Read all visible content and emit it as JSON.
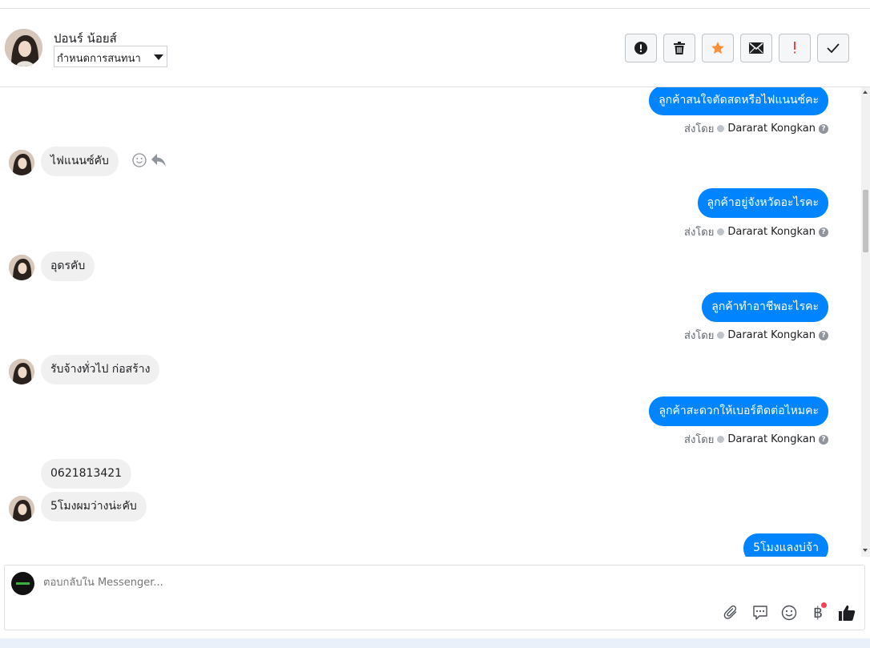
{
  "header": {
    "contact_name": "ปอนร์ น้อยส์",
    "status_select_value": "กำหนดการสนทนา",
    "actions": [
      {
        "icon": "alert-circle-icon"
      },
      {
        "icon": "trash-icon"
      },
      {
        "icon": "star-icon",
        "color": "#f7923b"
      },
      {
        "icon": "envelope-icon"
      },
      {
        "icon": "exclamation-icon",
        "color": "#fa3e3e"
      },
      {
        "icon": "checkmark-icon"
      }
    ]
  },
  "conversation": {
    "outgoing": [
      {
        "text": "ลูกค้าสนใจตัดสดหรือไฟแนนซ์คะ",
        "via": "ส่งโดย",
        "sender": "Dararat Kongkan"
      },
      {
        "text": "ลูกค้าอยู่จังหวัดอะไรคะ",
        "via": "ส่งโดย",
        "sender": "Dararat Kongkan"
      },
      {
        "text": "ลูกค้าทำอาชีพอะไรคะ",
        "via": "ส่งโดย",
        "sender": "Dararat Kongkan"
      },
      {
        "text": "ลูกค้าสะดวกให้เบอร์ติดต่อไหมคะ",
        "via": "ส่งโดย",
        "sender": "Dararat Kongkan"
      },
      {
        "text": "5โมงแลงบ่จ้า"
      }
    ],
    "incoming": [
      {
        "text": "ไฟแนนซ์คับ"
      },
      {
        "text": "อุดรคับ"
      },
      {
        "text": "รับจ้างทั่วไป ก่อสร้าง"
      },
      {
        "text": "0621813421"
      },
      {
        "text": "5โมงผมว่างน่ะคับ"
      }
    ]
  },
  "composer": {
    "placeholder": "ตอบกลับใน Messenger...",
    "tools": [
      "paperclip-icon",
      "saved-reply-icon",
      "emoji-icon",
      "baht-payment-icon",
      "thumbs-up-icon"
    ],
    "baht_symbol": "฿"
  },
  "colors": {
    "outgoing_bubble": "#0084ff",
    "incoming_bubble": "#f0f0f0",
    "notification_dot": "#fa3e5b"
  }
}
